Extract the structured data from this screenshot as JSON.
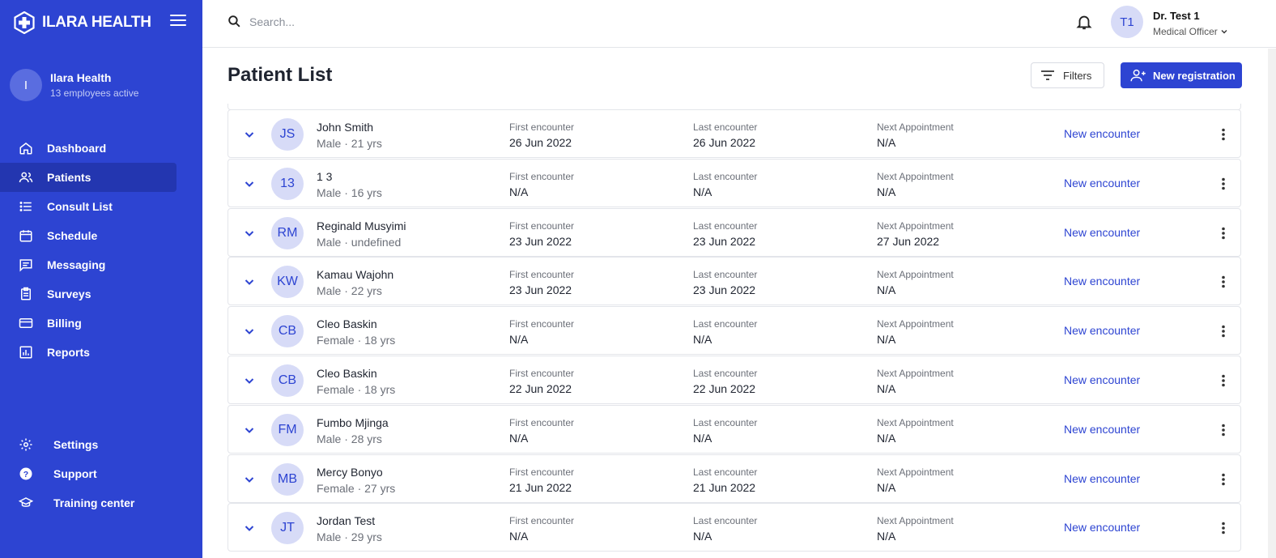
{
  "brand": {
    "name": "ILARA HEALTH"
  },
  "org": {
    "initial": "I",
    "name": "Ilara Health",
    "subtitle": "13 employees active"
  },
  "nav": [
    {
      "label": "Dashboard",
      "icon": "home-icon"
    },
    {
      "label": "Patients",
      "icon": "people-icon",
      "active": true
    },
    {
      "label": "Consult List",
      "icon": "list-icon"
    },
    {
      "label": "Schedule",
      "icon": "calendar-icon"
    },
    {
      "label": "Messaging",
      "icon": "message-icon"
    },
    {
      "label": "Surveys",
      "icon": "clipboard-icon"
    },
    {
      "label": "Billing",
      "icon": "credit-card-icon"
    },
    {
      "label": "Reports",
      "icon": "bar-chart-icon"
    }
  ],
  "bottom_nav": [
    {
      "label": "Settings",
      "icon": "gear-icon"
    },
    {
      "label": "Support",
      "icon": "help-icon"
    },
    {
      "label": "Training center",
      "icon": "graduation-cap-icon"
    }
  ],
  "search": {
    "placeholder": "Search..."
  },
  "user": {
    "initials": "T1",
    "name": "Dr. Test 1",
    "role": "Medical Officer"
  },
  "page": {
    "title": "Patient List",
    "filters_label": "Filters",
    "new_registration_label": "New registration"
  },
  "columns": {
    "first": "First encounter",
    "last": "Last encounter",
    "next": "Next Appointment",
    "action": "New encounter"
  },
  "patients": [
    {
      "initials": "JS",
      "name": "John Smith",
      "demo": "Male · 21 yrs",
      "first": "26 Jun 2022",
      "last": "26 Jun 2022",
      "next": "N/A"
    },
    {
      "initials": "13",
      "name": "1 3",
      "demo": "Male · 16 yrs",
      "first": "N/A",
      "last": "N/A",
      "next": "N/A"
    },
    {
      "initials": "RM",
      "name": "Reginald Musyimi",
      "demo": "Male · undefined",
      "first": "23 Jun 2022",
      "last": "23 Jun 2022",
      "next": "27 Jun 2022"
    },
    {
      "initials": "KW",
      "name": "Kamau Wajohn",
      "demo": "Male · 22 yrs",
      "first": "23 Jun 2022",
      "last": "23 Jun 2022",
      "next": "N/A"
    },
    {
      "initials": "CB",
      "name": "Cleo Baskin",
      "demo": "Female · 18 yrs",
      "first": "N/A",
      "last": "N/A",
      "next": "N/A"
    },
    {
      "initials": "CB",
      "name": "Cleo Baskin",
      "demo": "Female · 18 yrs",
      "first": "22 Jun 2022",
      "last": "22 Jun 2022",
      "next": "N/A"
    },
    {
      "initials": "FM",
      "name": "Fumbo Mjinga",
      "demo": "Male · 28 yrs",
      "first": "N/A",
      "last": "N/A",
      "next": "N/A"
    },
    {
      "initials": "MB",
      "name": "Mercy Bonyo",
      "demo": "Female · 27 yrs",
      "first": "21 Jun 2022",
      "last": "21 Jun 2022",
      "next": "N/A"
    },
    {
      "initials": "JT",
      "name": "Jordan Test",
      "demo": "Male · 29 yrs",
      "first": "N/A",
      "last": "N/A",
      "next": "N/A"
    }
  ],
  "colors": {
    "brand": "#2d44d2",
    "sidebar_active": "#2336b0",
    "avatar_bg": "#d7dbf7"
  }
}
